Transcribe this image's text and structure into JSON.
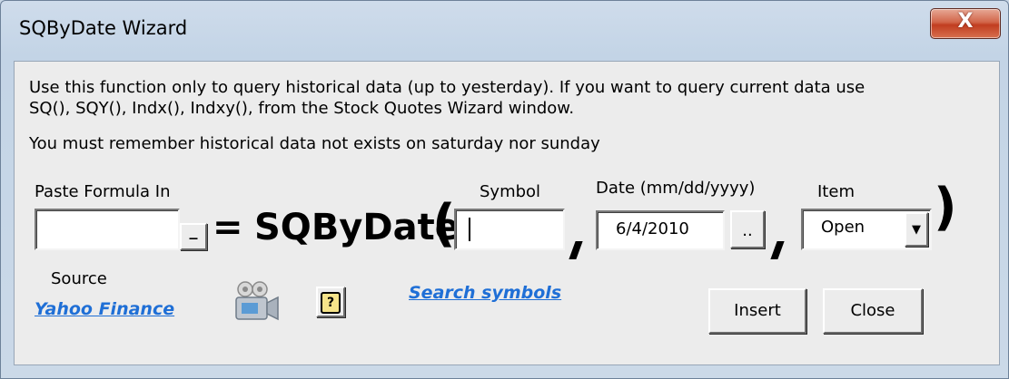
{
  "window": {
    "title": "SQByDate Wizard",
    "close_glyph": "X"
  },
  "info": {
    "line1": "Use this function only to query historical data (up to yesterday). If you want to query current data use",
    "line2": "SQ(), SQY(), Indx(), Indxy(), from the Stock Quotes Wizard window.",
    "line3": "You must remember historical data not exists on saturday nor sunday"
  },
  "fields": {
    "paste_label": "Paste Formula In",
    "paste_value": "",
    "paste_btn": "_",
    "equals": "=",
    "func_name": "SQByDate",
    "open_paren": "(",
    "close_paren": ")",
    "symbol_label": "Symbol",
    "symbol_value": "",
    "date_label": "Date (mm/dd/yyyy)",
    "date_value": "6/4/2010",
    "date_btn": "..",
    "item_label": "Item",
    "item_value": "Open",
    "item_arrow": "▼"
  },
  "footer": {
    "source_label": "Source",
    "source_link": "Yahoo Finance",
    "help_glyph": "?",
    "search_link": "Search symbols",
    "insert_label": "Insert",
    "close_label": "Close"
  }
}
